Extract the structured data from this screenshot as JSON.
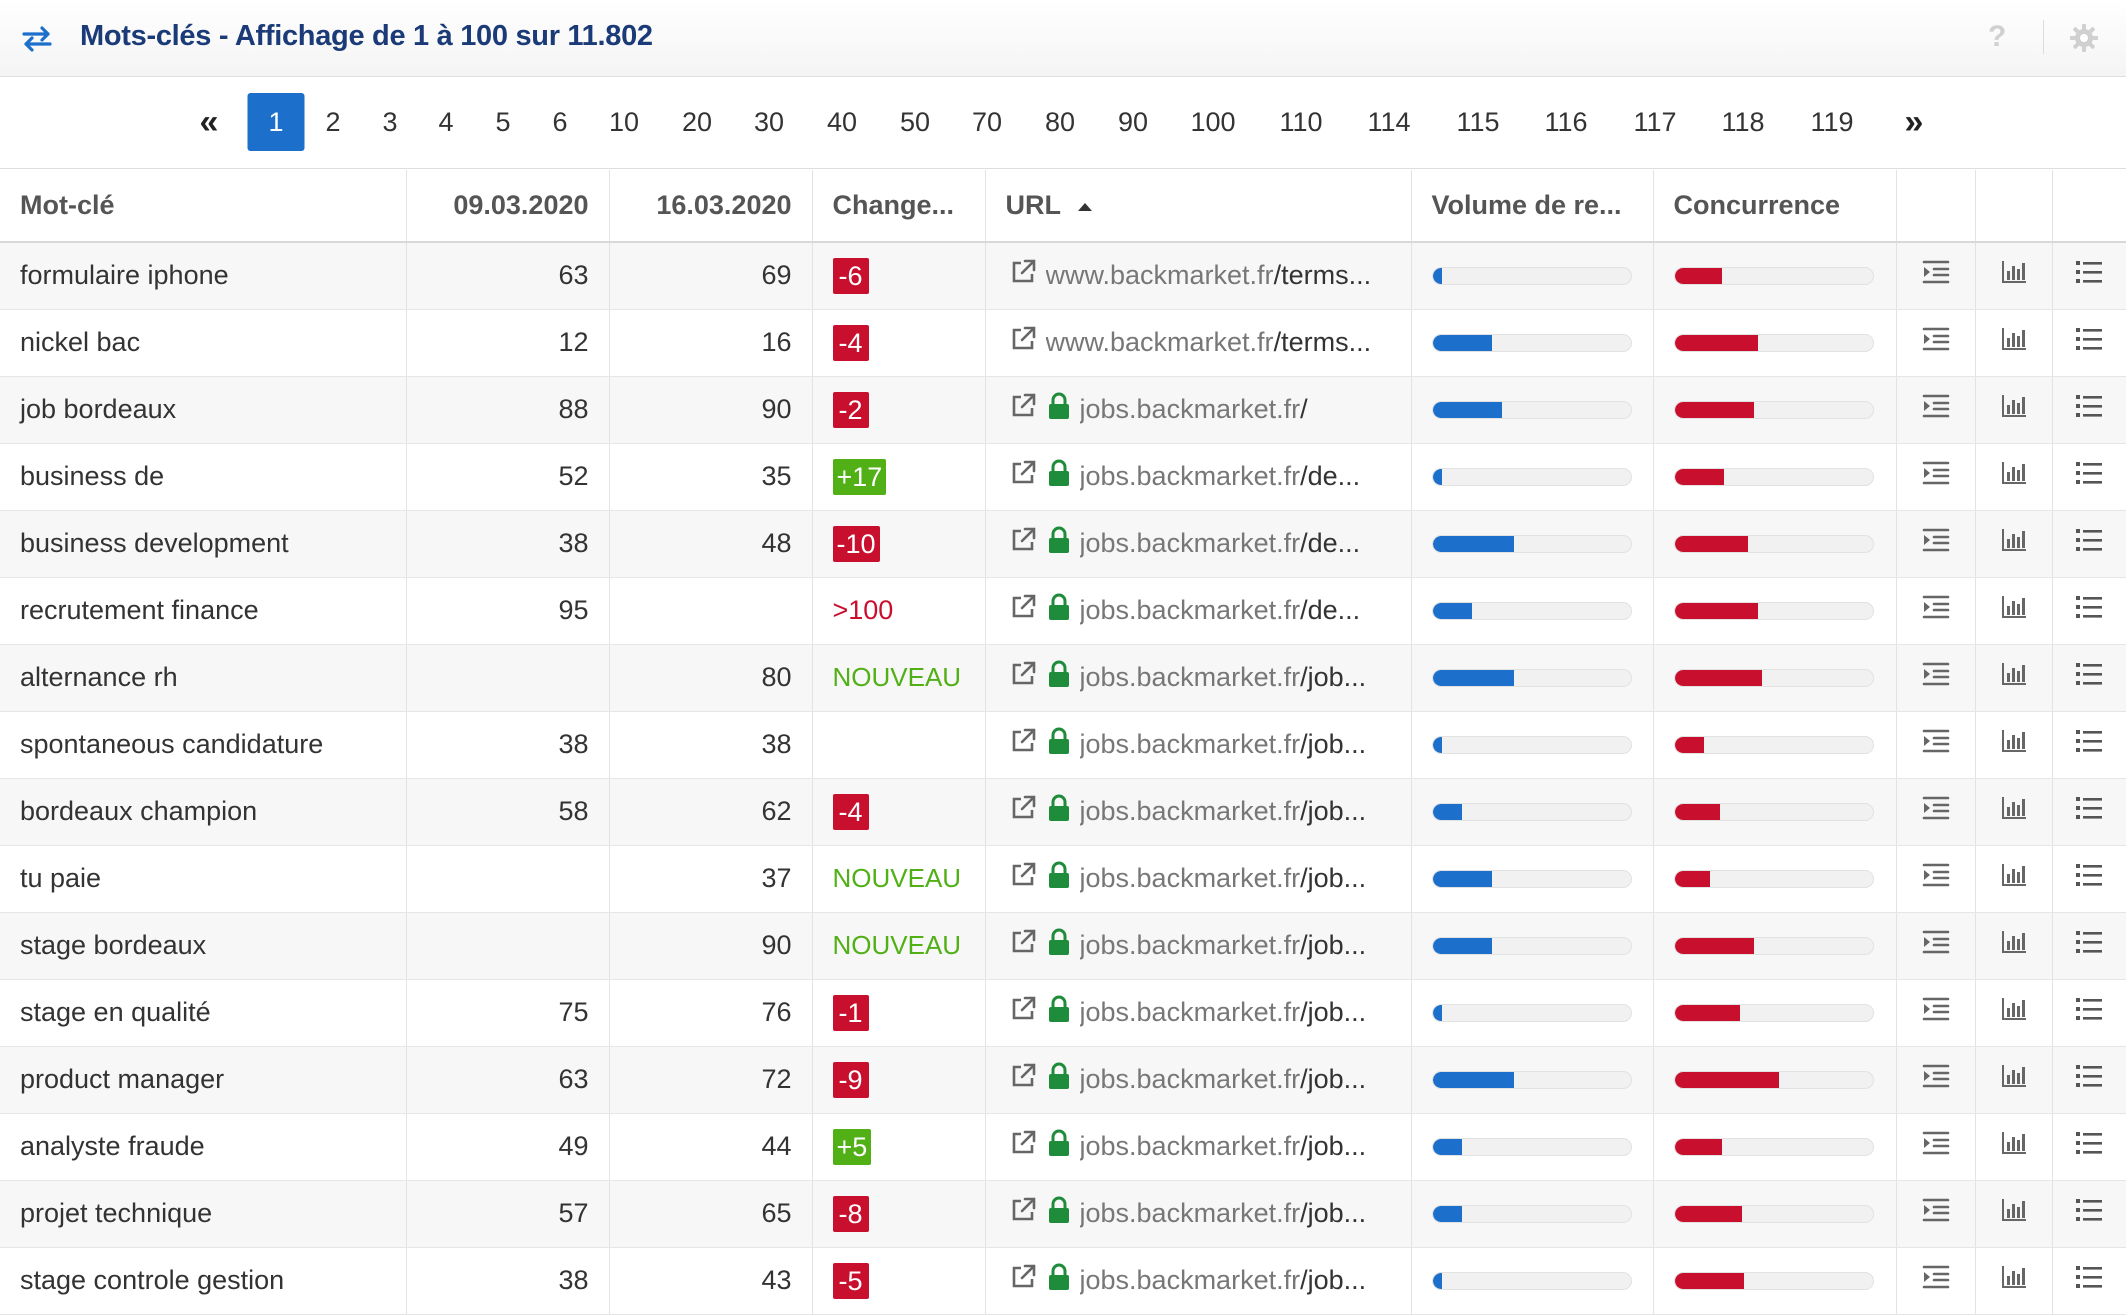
{
  "header": {
    "title": "Mots-clés - Affichage de 1 à 100 sur 11.802",
    "help_label": "?"
  },
  "pagination": {
    "first": "«",
    "last": "»",
    "active": "1",
    "pages": [
      "1",
      "2",
      "3",
      "4",
      "5",
      "6",
      "10",
      "20",
      "30",
      "40",
      "50",
      "70",
      "80",
      "90",
      "100",
      "110",
      "114",
      "115",
      "116",
      "117",
      "118",
      "119"
    ]
  },
  "table": {
    "columns": {
      "keyword": "Mot-clé",
      "date1": "09.03.2020",
      "date2": "16.03.2020",
      "change": "Change...",
      "url": "URL",
      "volume": "Volume de re...",
      "competition": "Concurrence"
    },
    "rows": [
      {
        "keyword": "formulaire iphone",
        "p1": "63",
        "p2": "69",
        "change": "-6",
        "change_type": "down",
        "url_domain": "www.backmarket.fr",
        "url_path": "/terms...",
        "secure": false,
        "volume": 0.05,
        "competition": 0.24
      },
      {
        "keyword": "nickel bac",
        "p1": "12",
        "p2": "16",
        "change": "-4",
        "change_type": "down",
        "url_domain": "www.backmarket.fr",
        "url_path": "/terms...",
        "secure": false,
        "volume": 0.3,
        "competition": 0.42
      },
      {
        "keyword": "job bordeaux",
        "p1": "88",
        "p2": "90",
        "change": "-2",
        "change_type": "down",
        "url_domain": "jobs.backmarket.fr",
        "url_path": "/",
        "secure": true,
        "volume": 0.35,
        "competition": 0.4
      },
      {
        "keyword": "business de",
        "p1": "52",
        "p2": "35",
        "change": "+17",
        "change_type": "up",
        "url_domain": "jobs.backmarket.fr",
        "url_path": "/de...",
        "secure": true,
        "volume": 0.05,
        "competition": 0.25
      },
      {
        "keyword": "business development",
        "p1": "38",
        "p2": "48",
        "change": "-10",
        "change_type": "down",
        "url_domain": "jobs.backmarket.fr",
        "url_path": "/de...",
        "secure": true,
        "volume": 0.41,
        "competition": 0.37
      },
      {
        "keyword": "recrutement finance",
        "p1": "95",
        "p2": "",
        "change": ">100",
        "change_type": "gt",
        "url_domain": "jobs.backmarket.fr",
        "url_path": "/de...",
        "secure": true,
        "volume": 0.2,
        "competition": 0.42
      },
      {
        "keyword": "alternance rh",
        "p1": "",
        "p2": "80",
        "change": "NOUVEAU",
        "change_type": "new",
        "url_domain": "jobs.backmarket.fr",
        "url_path": "/job...",
        "secure": true,
        "volume": 0.41,
        "competition": 0.44
      },
      {
        "keyword": "spontaneous candidature",
        "p1": "38",
        "p2": "38",
        "change": "",
        "change_type": "none",
        "url_domain": "jobs.backmarket.fr",
        "url_path": "/job...",
        "secure": true,
        "volume": 0.05,
        "competition": 0.15
      },
      {
        "keyword": "bordeaux champion",
        "p1": "58",
        "p2": "62",
        "change": "-4",
        "change_type": "down",
        "url_domain": "jobs.backmarket.fr",
        "url_path": "/job...",
        "secure": true,
        "volume": 0.15,
        "competition": 0.23
      },
      {
        "keyword": "tu paie",
        "p1": "",
        "p2": "37",
        "change": "NOUVEAU",
        "change_type": "new",
        "url_domain": "jobs.backmarket.fr",
        "url_path": "/job...",
        "secure": true,
        "volume": 0.3,
        "competition": 0.18
      },
      {
        "keyword": "stage bordeaux",
        "p1": "",
        "p2": "90",
        "change": "NOUVEAU",
        "change_type": "new",
        "url_domain": "jobs.backmarket.fr",
        "url_path": "/job...",
        "secure": true,
        "volume": 0.3,
        "competition": 0.4
      },
      {
        "keyword": "stage en qualité",
        "p1": "75",
        "p2": "76",
        "change": "-1",
        "change_type": "down",
        "url_domain": "jobs.backmarket.fr",
        "url_path": "/job...",
        "secure": true,
        "volume": 0.05,
        "competition": 0.33
      },
      {
        "keyword": "product manager",
        "p1": "63",
        "p2": "72",
        "change": "-9",
        "change_type": "down",
        "url_domain": "jobs.backmarket.fr",
        "url_path": "/job...",
        "secure": true,
        "volume": 0.41,
        "competition": 0.53
      },
      {
        "keyword": "analyste fraude",
        "p1": "49",
        "p2": "44",
        "change": "+5",
        "change_type": "up",
        "url_domain": "jobs.backmarket.fr",
        "url_path": "/job...",
        "secure": true,
        "volume": 0.15,
        "competition": 0.24
      },
      {
        "keyword": "projet technique",
        "p1": "57",
        "p2": "65",
        "change": "-8",
        "change_type": "down",
        "url_domain": "jobs.backmarket.fr",
        "url_path": "/job...",
        "secure": true,
        "volume": 0.15,
        "competition": 0.34
      },
      {
        "keyword": "stage controle gestion",
        "p1": "38",
        "p2": "43",
        "change": "-5",
        "change_type": "down",
        "url_domain": "jobs.backmarket.fr",
        "url_path": "/job...",
        "secure": true,
        "volume": 0.05,
        "competition": 0.35
      }
    ]
  },
  "colors": {
    "accent_blue": "#1d6fcc",
    "title_navy": "#1a3a78",
    "negative_red": "#c8102e",
    "positive_green": "#52b017",
    "secure_green": "#1e8c3a"
  },
  "icons": {
    "header_left": "swap-arrows-icon",
    "header_help": "help-icon",
    "header_settings": "gear-icon",
    "row_url_external": "external-link-icon",
    "row_url_secure": "lock-icon",
    "row_action_1": "serp-icon",
    "row_action_2": "bar-chart-icon",
    "row_action_3": "list-icon",
    "sort": "sort-asc-icon"
  }
}
